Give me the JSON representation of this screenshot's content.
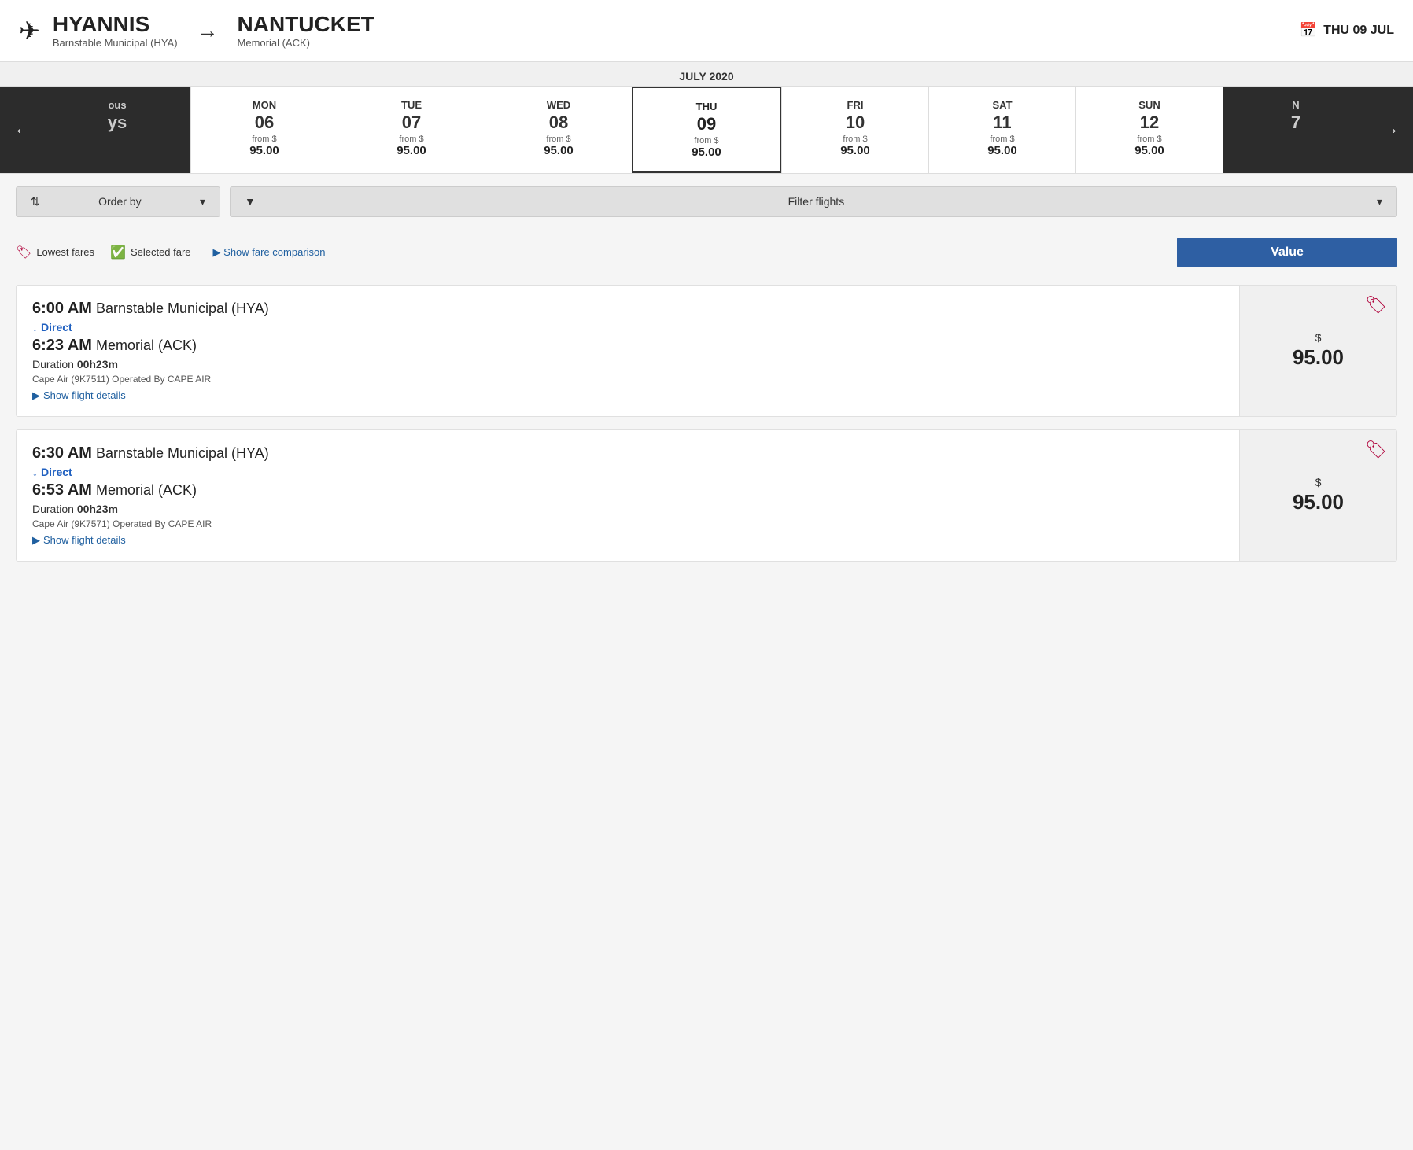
{
  "header": {
    "origin_city": "HYANNIS",
    "origin_airport": "Barnstable Municipal (HYA)",
    "dest_city": "NANTUCKET",
    "dest_airport": "Memorial (ACK)",
    "selected_date": "THU 09 JUL"
  },
  "carousel": {
    "month_label": "JULY 2020",
    "prev_label": "←",
    "next_label": "→",
    "dates": [
      {
        "id": "partial-prev",
        "day": "ous",
        "num": "ys",
        "from": "",
        "price": "",
        "partial": true,
        "selected": false
      },
      {
        "id": "mon-06",
        "day": "MON",
        "num": "06",
        "from": "from $",
        "price": "95.00",
        "partial": false,
        "selected": false
      },
      {
        "id": "tue-07",
        "day": "TUE",
        "num": "07",
        "from": "from $",
        "price": "95.00",
        "partial": false,
        "selected": false
      },
      {
        "id": "wed-08",
        "day": "WED",
        "num": "08",
        "from": "from $",
        "price": "95.00",
        "partial": false,
        "selected": false
      },
      {
        "id": "thu-09",
        "day": "THU",
        "num": "09",
        "from": "from $",
        "price": "95.00",
        "partial": false,
        "selected": true
      },
      {
        "id": "fri-10",
        "day": "FRI",
        "num": "10",
        "from": "from $",
        "price": "95.00",
        "partial": false,
        "selected": false
      },
      {
        "id": "sat-11",
        "day": "SAT",
        "num": "11",
        "from": "from $",
        "price": "95.00",
        "partial": false,
        "selected": false
      },
      {
        "id": "sun-12",
        "day": "SUN",
        "num": "12",
        "from": "from $",
        "price": "95.00",
        "partial": false,
        "selected": false
      },
      {
        "id": "partial-next",
        "day": "N",
        "num": "7",
        "from": "",
        "price": "",
        "partial": true,
        "selected": false
      }
    ]
  },
  "controls": {
    "order_label": "Order by",
    "filter_label": "Filter flights",
    "order_icon": "⇅",
    "filter_icon": "▼",
    "order_chevron": "▾",
    "filter_chevron": "▾"
  },
  "legend": {
    "lowest_fares_label": "Lowest fares",
    "selected_fare_label": "Selected fare",
    "show_fare_label": "▶ Show fare comparison",
    "value_header": "Value"
  },
  "flights": [
    {
      "id": "flight-1",
      "depart_time": "6:00 AM",
      "depart_airport": "Barnstable Municipal (HYA)",
      "direct_label": "Direct",
      "arrive_time": "6:23 AM",
      "arrive_airport": "Memorial (ACK)",
      "duration_label": "Duration",
      "duration_value": "00h23m",
      "operator": "Cape Air (9K7511) Operated By CAPE AIR",
      "show_details_label": "Show flight details",
      "price_dollar": "$",
      "price": "95.00"
    },
    {
      "id": "flight-2",
      "depart_time": "6:30 AM",
      "depart_airport": "Barnstable Municipal (HYA)",
      "direct_label": "Direct",
      "arrive_time": "6:53 AM",
      "arrive_airport": "Memorial (ACK)",
      "duration_label": "Duration",
      "duration_value": "00h23m",
      "operator": "Cape Air (9K7571) Operated By CAPE AIR",
      "show_details_label": "Show flight details",
      "price_dollar": "$",
      "price": "95.00"
    }
  ]
}
